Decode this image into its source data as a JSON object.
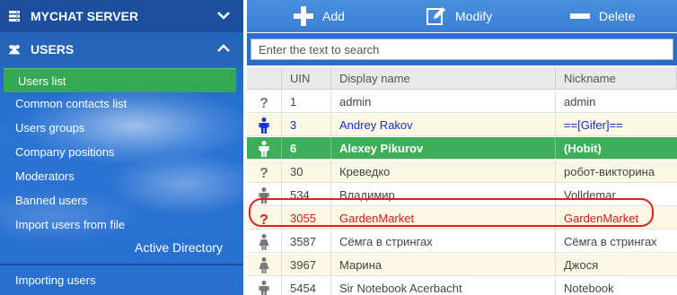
{
  "sidebar": {
    "server_header": "MYCHAT SERVER",
    "users_header": "USERS",
    "items": [
      {
        "label": "Users list"
      },
      {
        "label": "Common contacts list"
      },
      {
        "label": "Users groups"
      },
      {
        "label": "Company positions"
      },
      {
        "label": "Moderators"
      },
      {
        "label": "Banned users"
      },
      {
        "label": "Import users from file"
      }
    ],
    "active_directory": "Active Directory",
    "importing_users": "Importing users"
  },
  "toolbar": {
    "add_label": "Add",
    "modify_label": "Modify",
    "delete_label": "Delete"
  },
  "search": {
    "placeholder": "Enter the text to search",
    "value": ""
  },
  "table": {
    "columns": [
      "",
      "UIN",
      "Display name",
      "Nickname"
    ],
    "rows": [
      {
        "icon": "question-icon",
        "uin": "1",
        "name": "admin",
        "nick": "admin",
        "style": "normal"
      },
      {
        "icon": "male-user-icon",
        "uin": "3",
        "name": "Andrey Rakov",
        "nick": "==[Gifer]==",
        "style": "blue"
      },
      {
        "icon": "male-user-icon",
        "uin": "6",
        "name": "Alexey Pikurov",
        "nick": "(Hobit)",
        "style": "selected"
      },
      {
        "icon": "question-icon",
        "uin": "30",
        "name": "Креведко",
        "nick": "робот-викторина",
        "style": "normal"
      },
      {
        "icon": "male-user-icon",
        "uin": "534",
        "name": "Владимир",
        "nick": "Volldemar",
        "style": "normal"
      },
      {
        "icon": "question-icon",
        "uin": "3055",
        "name": "GardenMarket",
        "nick": "GardenMarket",
        "style": "red"
      },
      {
        "icon": "female-user-icon",
        "uin": "3587",
        "name": "Сёмга в стрингах",
        "nick": "Сёмга в стрингах",
        "style": "normal"
      },
      {
        "icon": "female-user-icon",
        "uin": "3967",
        "name": "Марина",
        "nick": "Джося",
        "style": "normal"
      },
      {
        "icon": "male-user-icon",
        "uin": "5454",
        "name": "Sir Notebook Acerbacht",
        "nick": "Notebook",
        "style": "normal"
      }
    ]
  },
  "colors": {
    "sidebar_blue": "#2a6fd0",
    "active_green": "#34a853",
    "selected_row": "#3fae5a",
    "alt_row": "#fbf8e3",
    "blue_text": "#1a32c8",
    "red_text": "#d41a1a",
    "highlight_outline": "#e02020"
  }
}
